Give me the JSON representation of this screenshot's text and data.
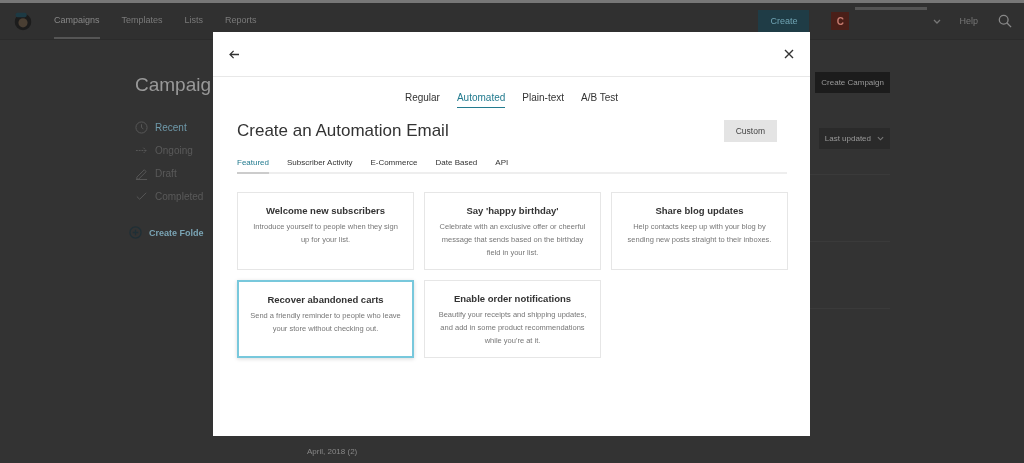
{
  "nav": {
    "items": [
      {
        "label": "Campaigns",
        "selected": true
      },
      {
        "label": "Templates",
        "selected": false
      },
      {
        "label": "Lists",
        "selected": false
      },
      {
        "label": "Reports",
        "selected": false
      }
    ],
    "create_button": "Create",
    "avatar": "C",
    "help": "Help"
  },
  "page": {
    "title": "Campaig",
    "create_campaign": "Create Campaign",
    "sort": "Last updated",
    "sidebar": [
      {
        "label": "Recent",
        "kind": "clock",
        "selected": true
      },
      {
        "label": "Ongoing",
        "kind": "arrow",
        "selected": false
      },
      {
        "label": "Draft",
        "kind": "pencil",
        "selected": false
      },
      {
        "label": "Completed",
        "kind": "check",
        "selected": false
      }
    ],
    "create_folder": "Create Folde",
    "month": "April, 2018 (2)"
  },
  "modal": {
    "type_tabs": [
      {
        "label": "Regular",
        "selected": false
      },
      {
        "label": "Automated",
        "selected": true
      },
      {
        "label": "Plain-text",
        "selected": false
      },
      {
        "label": "A/B Test",
        "selected": false
      }
    ],
    "title": "Create an Automation Email",
    "custom_button": "Custom",
    "category_tabs": [
      {
        "label": "Featured",
        "selected": true
      },
      {
        "label": "Subscriber Activity",
        "selected": false
      },
      {
        "label": "E-Commerce",
        "selected": false
      },
      {
        "label": "Date Based",
        "selected": false
      },
      {
        "label": "API",
        "selected": false
      }
    ],
    "cards": [
      {
        "title": "Welcome new subscribers",
        "text": "Introduce yourself to people when they sign up for your list.",
        "selected": false
      },
      {
        "title": "Say 'happy birthday'",
        "text": "Celebrate with an exclusive offer or cheerful message that sends based on the birthday field in your list.",
        "selected": false
      },
      {
        "title": "Share blog updates",
        "text": "Help contacts keep up with your blog by sending new posts straight to their inboxes.",
        "selected": false
      },
      {
        "title": "Recover abandoned carts",
        "text": "Send a friendly reminder to people who leave your store without checking out.",
        "selected": true
      },
      {
        "title": "Enable order notifications",
        "text": "Beautify your receipts and shipping updates, and add in some product recommendations while you're at it.",
        "selected": false
      }
    ]
  }
}
